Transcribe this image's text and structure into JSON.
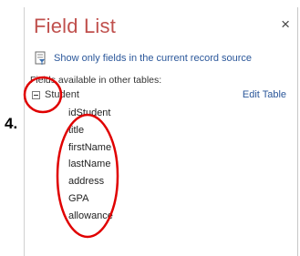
{
  "step": {
    "number": "4."
  },
  "panel": {
    "title": "Field List",
    "close_glyph": "×",
    "show_only_label": "Show only fields in the current record source",
    "section_label": "Fields available in other tables:",
    "table": {
      "name": "Student",
      "edit_label": "Edit Table",
      "fields": [
        "idStudent",
        "title",
        "firstName",
        "lastName",
        "address",
        "GPA",
        "allowance"
      ]
    }
  },
  "icons": {
    "close": "close-icon",
    "filter": "document-filter-icon",
    "collapse": "collapse-minus-icon"
  },
  "colors": {
    "title": "#c0504d",
    "link": "#2b579a",
    "annotation": "#e00000"
  }
}
